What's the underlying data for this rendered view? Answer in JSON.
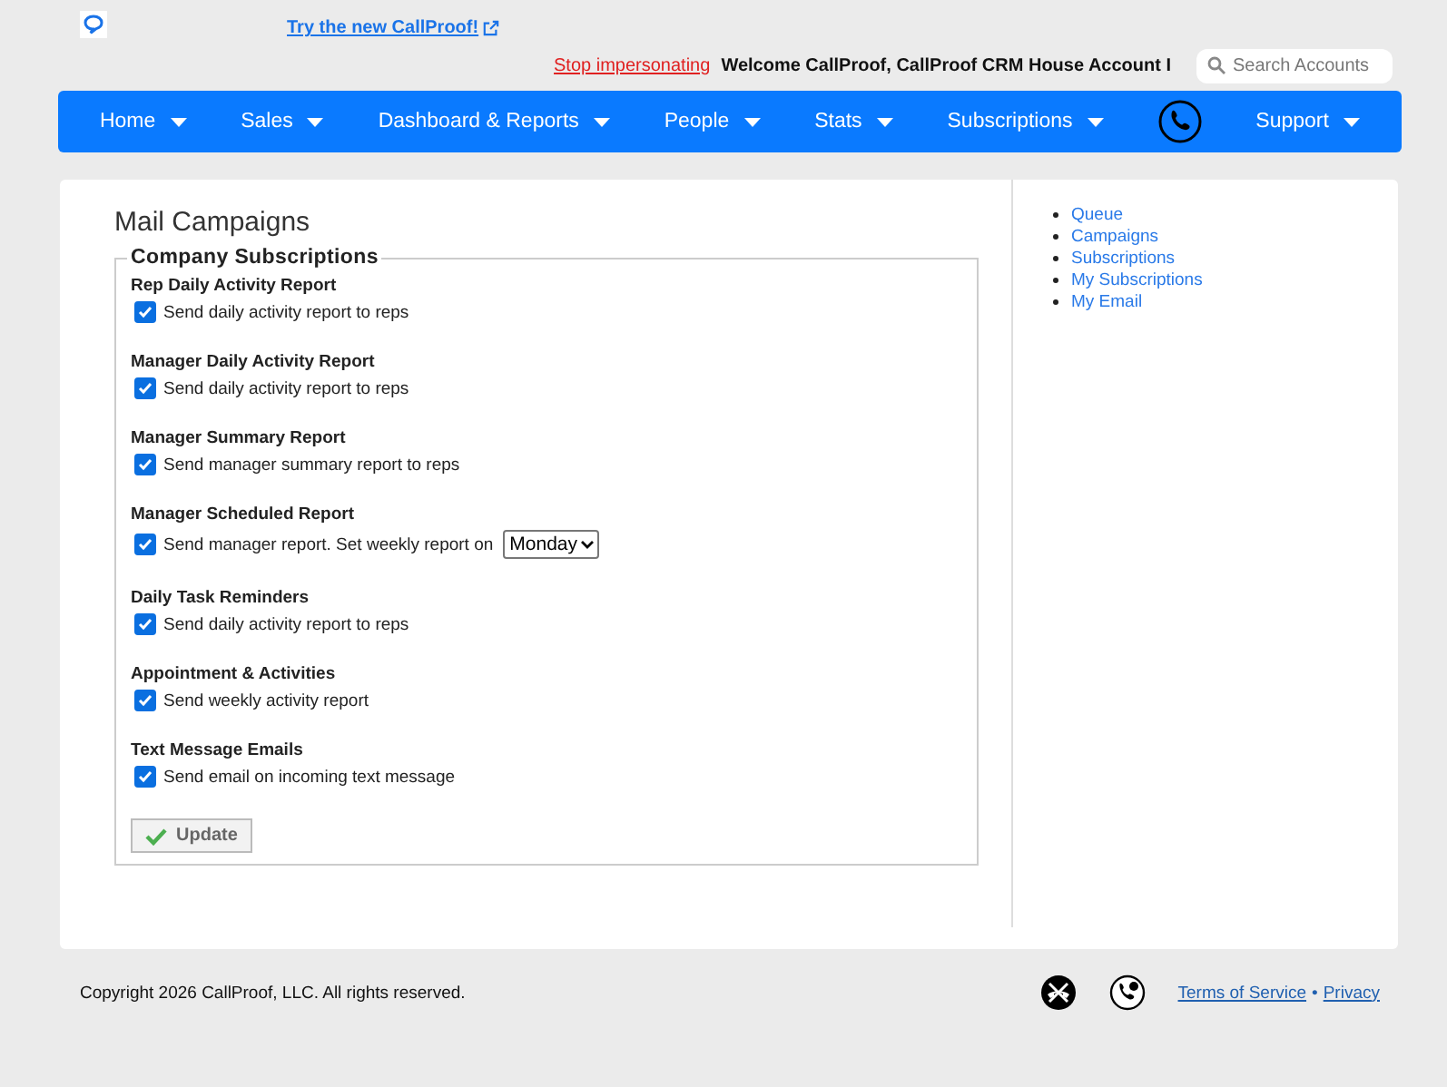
{
  "header": {
    "promo_link": "Try the new CallProof!",
    "stop_link": "Stop impersonating",
    "welcome": "Welcome CallProof, CallProof CRM House Account I",
    "search": {
      "placeholder": "Search Accounts"
    }
  },
  "nav": [
    {
      "label": "Home",
      "kind": "menu"
    },
    {
      "label": "Sales",
      "kind": "menu"
    },
    {
      "label": "Dashboard & Reports",
      "kind": "menu"
    },
    {
      "label": "People",
      "kind": "menu"
    },
    {
      "label": "Stats",
      "kind": "menu"
    },
    {
      "label": "Subscriptions",
      "kind": "menu"
    },
    {
      "kind": "phone"
    },
    {
      "label": "Support",
      "kind": "menu"
    }
  ],
  "page": {
    "title": "Mail Campaigns",
    "fieldset": "Company Subscriptions",
    "sections": [
      {
        "heading": "Rep Daily Activity Report",
        "label": "Send daily activity report to reps",
        "checked": true
      },
      {
        "heading": "Manager Daily Activity Report",
        "label": "Send daily activity report to reps",
        "checked": true
      },
      {
        "heading": "Manager Summary Report",
        "label": "Send manager summary report to reps",
        "checked": true
      },
      {
        "heading": "Manager Scheduled Report",
        "label": "Send manager report. Set weekly report on",
        "checked": true,
        "select": "Monday"
      },
      {
        "heading": "Daily Task Reminders",
        "label": "Send daily activity report to reps",
        "checked": true
      },
      {
        "heading": "Appointment & Activities",
        "label": "Send weekly activity report",
        "checked": true
      },
      {
        "heading": "Text Message Emails",
        "label": "Send email on incoming text message",
        "checked": true
      }
    ],
    "button": "Update"
  },
  "side_links": [
    "Queue",
    "Campaigns",
    "Subscriptions",
    "My Subscriptions",
    "My Email"
  ],
  "footer": {
    "copyright": "Copyright 2026 CallProof, LLC. All rights reserved.",
    "links": [
      "Terms of Service",
      "Privacy"
    ],
    "separator": "•"
  }
}
